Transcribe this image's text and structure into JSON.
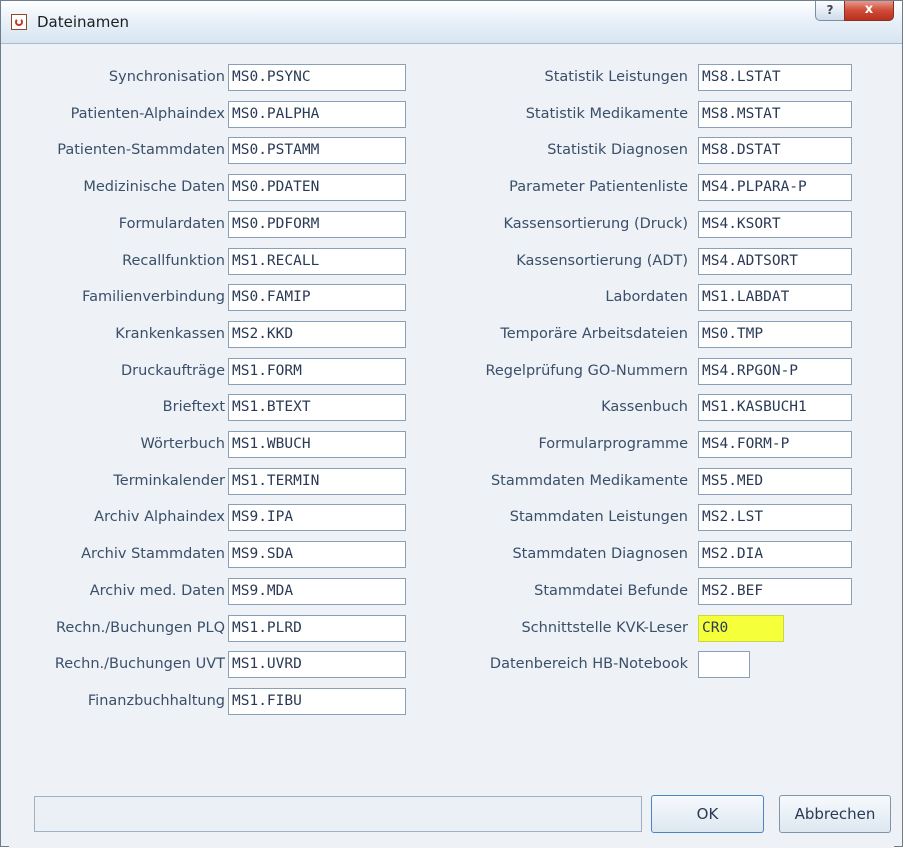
{
  "window": {
    "title": "Dateinamen",
    "help_label": "?",
    "close_label": "x"
  },
  "left_fields": [
    {
      "label": "Synchronisation",
      "value": "MS0.PSYNC"
    },
    {
      "label": "Patienten-Alphaindex",
      "value": "MS0.PALPHA"
    },
    {
      "label": "Patienten-Stammdaten",
      "value": "MS0.PSTAMM"
    },
    {
      "label": "Medizinische Daten",
      "value": "MS0.PDATEN"
    },
    {
      "label": "Formulardaten",
      "value": "MS0.PDFORM"
    },
    {
      "label": "Recallfunktion",
      "value": "MS1.RECALL"
    },
    {
      "label": "Familienverbindung",
      "value": "MS0.FAMIP"
    },
    {
      "label": "Krankenkassen",
      "value": "MS2.KKD"
    },
    {
      "label": "Druckaufträge",
      "value": "MS1.FORM"
    },
    {
      "label": "Brieftext",
      "value": "MS1.BTEXT"
    },
    {
      "label": "Wörterbuch",
      "value": "MS1.WBUCH"
    },
    {
      "label": "Terminkalender",
      "value": "MS1.TERMIN"
    },
    {
      "label": "Archiv Alphaindex",
      "value": "MS9.IPA"
    },
    {
      "label": "Archiv Stammdaten",
      "value": "MS9.SDA"
    },
    {
      "label": "Archiv med. Daten",
      "value": "MS9.MDA"
    },
    {
      "label": "Rechn./Buchungen PLQ",
      "value": "MS1.PLRD"
    },
    {
      "label": "Rechn./Buchungen UVT",
      "value": "MS1.UVRD"
    },
    {
      "label": "Finanzbuchhaltung",
      "value": "MS1.FIBU"
    }
  ],
  "right_fields": [
    {
      "label": "Statistik Leistungen",
      "value": "MS8.LSTAT"
    },
    {
      "label": "Statistik Medikamente",
      "value": "MS8.MSTAT"
    },
    {
      "label": "Statistik Diagnosen",
      "value": "MS8.DSTAT"
    },
    {
      "label": "Parameter Patientenliste",
      "value": "MS4.PLPARA-P"
    },
    {
      "label": "Kassensortierung (Druck)",
      "value": "MS4.KSORT"
    },
    {
      "label": "Kassensortierung (ADT)",
      "value": "MS4.ADTSORT"
    },
    {
      "label": "Labordaten",
      "value": "MS1.LABDAT"
    },
    {
      "label": "Temporäre Arbeitsdateien",
      "value": "MS0.TMP"
    },
    {
      "label": "Regelprüfung GO-Nummern",
      "value": "MS4.RPGON-P"
    },
    {
      "label": "Kassenbuch",
      "value": "MS1.KASBUCH1"
    },
    {
      "label": "Formularprogramme",
      "value": "MS4.FORM-P"
    },
    {
      "label": "Stammdaten Medikamente",
      "value": "MS5.MED"
    },
    {
      "label": "Stammdaten Leistungen",
      "value": "MS2.LST"
    },
    {
      "label": "Stammdaten Diagnosen",
      "value": "MS2.DIA"
    },
    {
      "label": "Stammdatei Befunde",
      "value": "MS2.BEF"
    },
    {
      "label": "Schnittstelle KVK-Leser",
      "value": "CR0",
      "highlight": true
    },
    {
      "label": "Datenbereich HB-Notebook",
      "value": ""
    }
  ],
  "buttons": {
    "ok": "OK",
    "cancel": "Abbrechen"
  },
  "status_text": "",
  "colors": {
    "highlight": "#f5ff3a",
    "label_text": "#3a4f6a",
    "close_button": "#cf4c37"
  }
}
